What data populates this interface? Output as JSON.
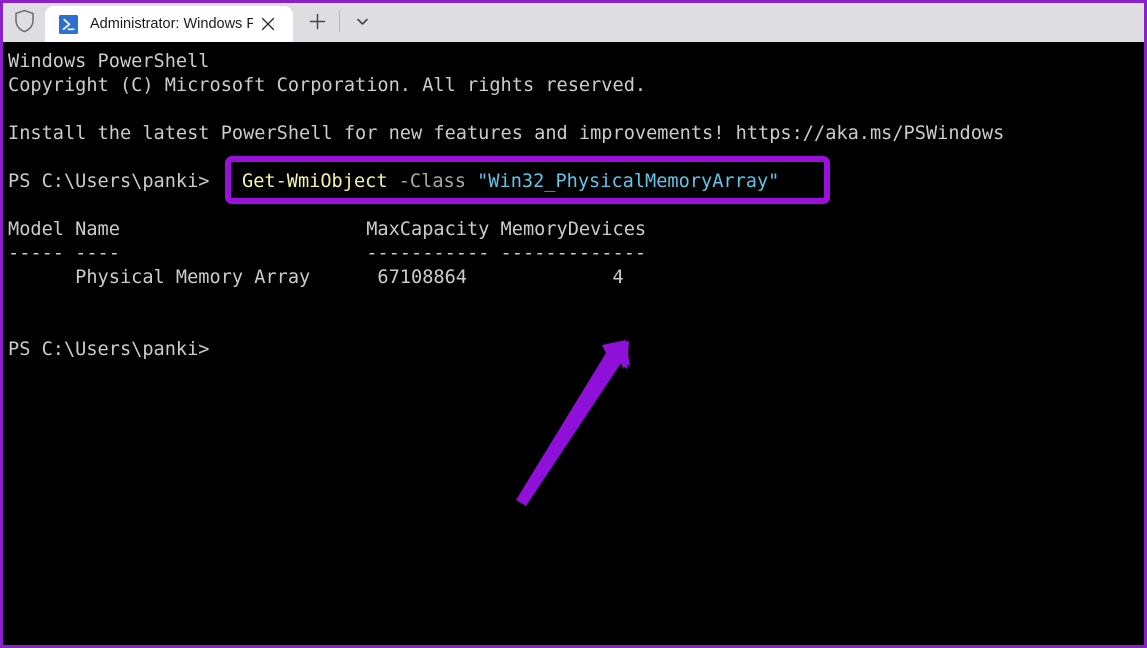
{
  "window": {
    "border_color": "#8a20c9",
    "background": "#000000"
  },
  "titlebar": {
    "background": "#dedde1",
    "shield_icon": "shield-icon",
    "tab": {
      "icon": "powershell-icon",
      "title": "Administrator: Windows Powe",
      "close_icon": "close-icon"
    },
    "new_tab_label": "+",
    "dropdown_icon": "chevron-down-icon"
  },
  "terminal": {
    "foreground": "#cccccc",
    "lines": [
      "Windows PowerShell",
      "Copyright (C) Microsoft Corporation. All rights reserved.",
      "",
      "Install the latest PowerShell for new features and improvements! https://aka.ms/PSWindows",
      ""
    ],
    "prompt_1": "PS C:\\Users\\panki>",
    "command": {
      "cmdlet": "Get-WmiObject",
      "parameter": "-Class",
      "argument": "\"Win32_PhysicalMemoryArray\"",
      "cmdlet_color": "#f5f3a7",
      "parameter_color": "#a8a8a8",
      "argument_color": "#5fc6e8"
    },
    "output": {
      "header": "Model Name                      MaxCapacity MemoryDevices",
      "separator": "----- ----                      ----------- -------------",
      "row": "      Physical Memory Array      67108864             4",
      "columns": [
        "Model",
        "Name",
        "MaxCapacity",
        "MemoryDevices"
      ],
      "values": [
        "",
        "Physical Memory Array",
        "67108864",
        "4"
      ]
    },
    "prompt_2": "PS C:\\Users\\panki>"
  },
  "annotations": {
    "highlight_box_color": "#9b0fdb",
    "arrow_color": "#8f10d8"
  }
}
